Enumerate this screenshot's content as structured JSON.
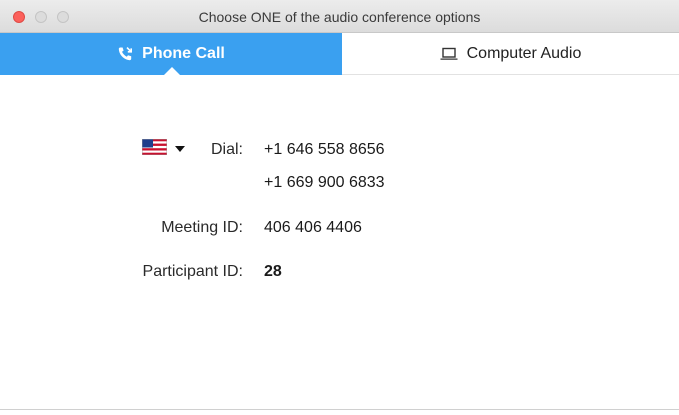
{
  "window": {
    "title": "Choose ONE of the audio conference options"
  },
  "tabs": [
    {
      "label": "Phone Call",
      "icon": "phone-icon",
      "selected": true
    },
    {
      "label": "Computer Audio",
      "icon": "laptop-icon",
      "selected": false
    }
  ],
  "dial": {
    "country": "United States",
    "flag_icon": "us-flag-icon",
    "label": "Dial:",
    "numbers": [
      "+1 646 558 8656",
      "+1 669 900 6833"
    ]
  },
  "meeting": {
    "label": "Meeting ID:",
    "value": "406 406 4406"
  },
  "participant": {
    "label": "Participant ID:",
    "value": "28"
  },
  "colors": {
    "accent": "#3aa0f0",
    "close_button": "#fc605b"
  }
}
